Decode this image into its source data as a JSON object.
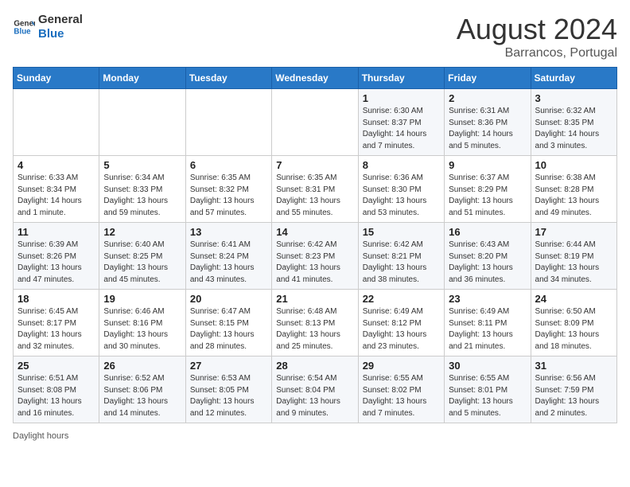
{
  "header": {
    "logo_line1": "General",
    "logo_line2": "Blue",
    "month": "August 2024",
    "location": "Barrancos, Portugal"
  },
  "weekdays": [
    "Sunday",
    "Monday",
    "Tuesday",
    "Wednesday",
    "Thursday",
    "Friday",
    "Saturday"
  ],
  "weeks": [
    [
      {
        "day": "",
        "info": ""
      },
      {
        "day": "",
        "info": ""
      },
      {
        "day": "",
        "info": ""
      },
      {
        "day": "",
        "info": ""
      },
      {
        "day": "1",
        "info": "Sunrise: 6:30 AM\nSunset: 8:37 PM\nDaylight: 14 hours\nand 7 minutes."
      },
      {
        "day": "2",
        "info": "Sunrise: 6:31 AM\nSunset: 8:36 PM\nDaylight: 14 hours\nand 5 minutes."
      },
      {
        "day": "3",
        "info": "Sunrise: 6:32 AM\nSunset: 8:35 PM\nDaylight: 14 hours\nand 3 minutes."
      }
    ],
    [
      {
        "day": "4",
        "info": "Sunrise: 6:33 AM\nSunset: 8:34 PM\nDaylight: 14 hours\nand 1 minute."
      },
      {
        "day": "5",
        "info": "Sunrise: 6:34 AM\nSunset: 8:33 PM\nDaylight: 13 hours\nand 59 minutes."
      },
      {
        "day": "6",
        "info": "Sunrise: 6:35 AM\nSunset: 8:32 PM\nDaylight: 13 hours\nand 57 minutes."
      },
      {
        "day": "7",
        "info": "Sunrise: 6:35 AM\nSunset: 8:31 PM\nDaylight: 13 hours\nand 55 minutes."
      },
      {
        "day": "8",
        "info": "Sunrise: 6:36 AM\nSunset: 8:30 PM\nDaylight: 13 hours\nand 53 minutes."
      },
      {
        "day": "9",
        "info": "Sunrise: 6:37 AM\nSunset: 8:29 PM\nDaylight: 13 hours\nand 51 minutes."
      },
      {
        "day": "10",
        "info": "Sunrise: 6:38 AM\nSunset: 8:28 PM\nDaylight: 13 hours\nand 49 minutes."
      }
    ],
    [
      {
        "day": "11",
        "info": "Sunrise: 6:39 AM\nSunset: 8:26 PM\nDaylight: 13 hours\nand 47 minutes."
      },
      {
        "day": "12",
        "info": "Sunrise: 6:40 AM\nSunset: 8:25 PM\nDaylight: 13 hours\nand 45 minutes."
      },
      {
        "day": "13",
        "info": "Sunrise: 6:41 AM\nSunset: 8:24 PM\nDaylight: 13 hours\nand 43 minutes."
      },
      {
        "day": "14",
        "info": "Sunrise: 6:42 AM\nSunset: 8:23 PM\nDaylight: 13 hours\nand 41 minutes."
      },
      {
        "day": "15",
        "info": "Sunrise: 6:42 AM\nSunset: 8:21 PM\nDaylight: 13 hours\nand 38 minutes."
      },
      {
        "day": "16",
        "info": "Sunrise: 6:43 AM\nSunset: 8:20 PM\nDaylight: 13 hours\nand 36 minutes."
      },
      {
        "day": "17",
        "info": "Sunrise: 6:44 AM\nSunset: 8:19 PM\nDaylight: 13 hours\nand 34 minutes."
      }
    ],
    [
      {
        "day": "18",
        "info": "Sunrise: 6:45 AM\nSunset: 8:17 PM\nDaylight: 13 hours\nand 32 minutes."
      },
      {
        "day": "19",
        "info": "Sunrise: 6:46 AM\nSunset: 8:16 PM\nDaylight: 13 hours\nand 30 minutes."
      },
      {
        "day": "20",
        "info": "Sunrise: 6:47 AM\nSunset: 8:15 PM\nDaylight: 13 hours\nand 28 minutes."
      },
      {
        "day": "21",
        "info": "Sunrise: 6:48 AM\nSunset: 8:13 PM\nDaylight: 13 hours\nand 25 minutes."
      },
      {
        "day": "22",
        "info": "Sunrise: 6:49 AM\nSunset: 8:12 PM\nDaylight: 13 hours\nand 23 minutes."
      },
      {
        "day": "23",
        "info": "Sunrise: 6:49 AM\nSunset: 8:11 PM\nDaylight: 13 hours\nand 21 minutes."
      },
      {
        "day": "24",
        "info": "Sunrise: 6:50 AM\nSunset: 8:09 PM\nDaylight: 13 hours\nand 18 minutes."
      }
    ],
    [
      {
        "day": "25",
        "info": "Sunrise: 6:51 AM\nSunset: 8:08 PM\nDaylight: 13 hours\nand 16 minutes."
      },
      {
        "day": "26",
        "info": "Sunrise: 6:52 AM\nSunset: 8:06 PM\nDaylight: 13 hours\nand 14 minutes."
      },
      {
        "day": "27",
        "info": "Sunrise: 6:53 AM\nSunset: 8:05 PM\nDaylight: 13 hours\nand 12 minutes."
      },
      {
        "day": "28",
        "info": "Sunrise: 6:54 AM\nSunset: 8:04 PM\nDaylight: 13 hours\nand 9 minutes."
      },
      {
        "day": "29",
        "info": "Sunrise: 6:55 AM\nSunset: 8:02 PM\nDaylight: 13 hours\nand 7 minutes."
      },
      {
        "day": "30",
        "info": "Sunrise: 6:55 AM\nSunset: 8:01 PM\nDaylight: 13 hours\nand 5 minutes."
      },
      {
        "day": "31",
        "info": "Sunrise: 6:56 AM\nSunset: 7:59 PM\nDaylight: 13 hours\nand 2 minutes."
      }
    ]
  ],
  "footer": "Daylight hours"
}
